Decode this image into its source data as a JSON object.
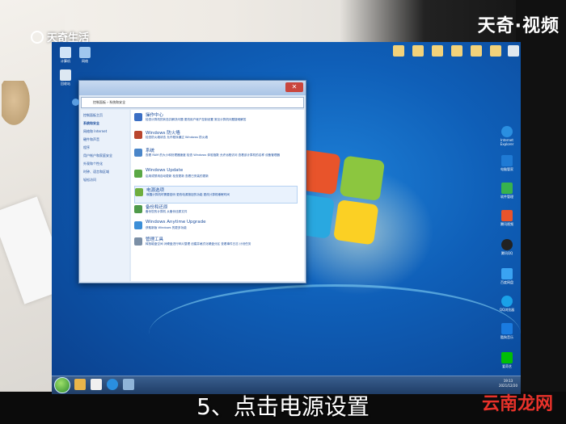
{
  "watermark": {
    "label": "天奇生活"
  },
  "brand_top": "天奇·视频",
  "brand_bottom": "云南龙网",
  "subtitle": "5、点击电源设置",
  "window": {
    "address": "控制面板 › 系统和安全",
    "sidebar": [
      "控制面板主页",
      "系统和安全",
      "网络和 Internet",
      "硬件和声音",
      "程序",
      "用户帐户和家庭安全",
      "外观和个性化",
      "时钟、语言和区域",
      "轻松访问"
    ],
    "categories": [
      {
        "title": "操作中心",
        "links": "检查计算机的状态并解决问题  更改用户帐户控制设置  常见计算机问题疑难解答"
      },
      {
        "title": "Windows 防火墙",
        "links": "检查防火墙状态  允许程序通过 Windows 防火墙"
      },
      {
        "title": "系统",
        "links": "查看 RAM 的大小和处理器速度  检查 Windows 体验指数  允许远程访问  查看该计算机的名称  设备管理器"
      },
      {
        "title": "Windows Update",
        "links": "启用或禁用自动更新  检查更新  查看已安装的更新"
      },
      {
        "title": "电源选项",
        "links": "唤醒计算机时需要密码  更改电源按钮的功能  更改计算机睡眠时间"
      },
      {
        "title": "备份和还原",
        "links": "备份您的计算机  从备份还原文件"
      },
      {
        "title": "Windows Anytime Upgrade",
        "links": "获取新版 Windows 的更多功能"
      },
      {
        "title": "管理工具",
        "links": "释放磁盘空间  对硬盘进行碎片整理  创建并格式化硬盘分区  查看事件日志  计划任务"
      }
    ]
  },
  "desktop_icons": {
    "left": [
      "计算机",
      "网络",
      "回收站"
    ],
    "right": [
      "Internet Explorer",
      "电脑管家",
      "软件管理",
      "腾讯视频",
      "腾讯QQ",
      "百度网盘",
      "QQ浏览器",
      "酷狗音乐",
      "爱奇艺"
    ]
  },
  "tray": {
    "time": "19:13",
    "date": "2021/12/20"
  },
  "colors": {
    "accent": "#1a4c9c",
    "desktop": "#0f5fb8",
    "brand_red": "#e8322a"
  }
}
